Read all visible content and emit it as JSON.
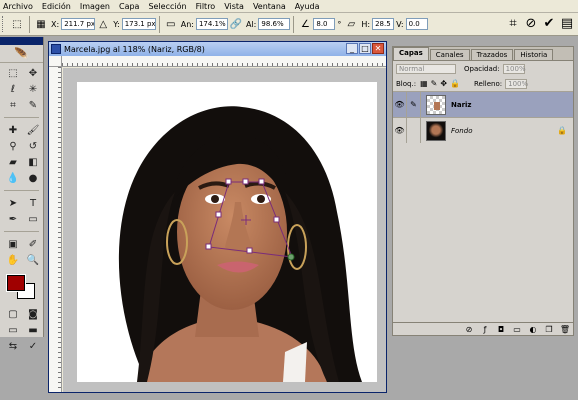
{
  "menu": [
    "Archivo",
    "Edición",
    "Imagen",
    "Capa",
    "Selección",
    "Filtro",
    "Vista",
    "Ventana",
    "Ayuda"
  ],
  "options": {
    "x_label": "X:",
    "x_value": "211.7 px",
    "y_label": "Y:",
    "y_value": "173.1 px",
    "w_label": "An:",
    "w_value": "174.1%",
    "h_label": "Al:",
    "h_value": "98.6%",
    "angle_value": "8.0",
    "hskew_label": "H:",
    "hskew_value": "28.5",
    "vskew_label": "V:",
    "vskew_value": "0.0"
  },
  "document": {
    "title": "Marcela.jpg al 118% (Nariz, RGB/8)"
  },
  "colors": {
    "foreground": "#a00000",
    "background": "#ffffff",
    "selected_layer": "#9aa1bd"
  },
  "layers_panel": {
    "tabs": [
      "Capas",
      "Canales",
      "Trazados",
      "Historia"
    ],
    "blend_mode": "Normal",
    "opacity_label": "Opacidad:",
    "opacity_value": "100%",
    "lock_label": "Bloq.:",
    "fill_label": "Relleno:",
    "fill_value": "100%",
    "layers": [
      {
        "name": "Nariz",
        "selected": true
      },
      {
        "name": "Fondo",
        "selected": false
      }
    ]
  }
}
